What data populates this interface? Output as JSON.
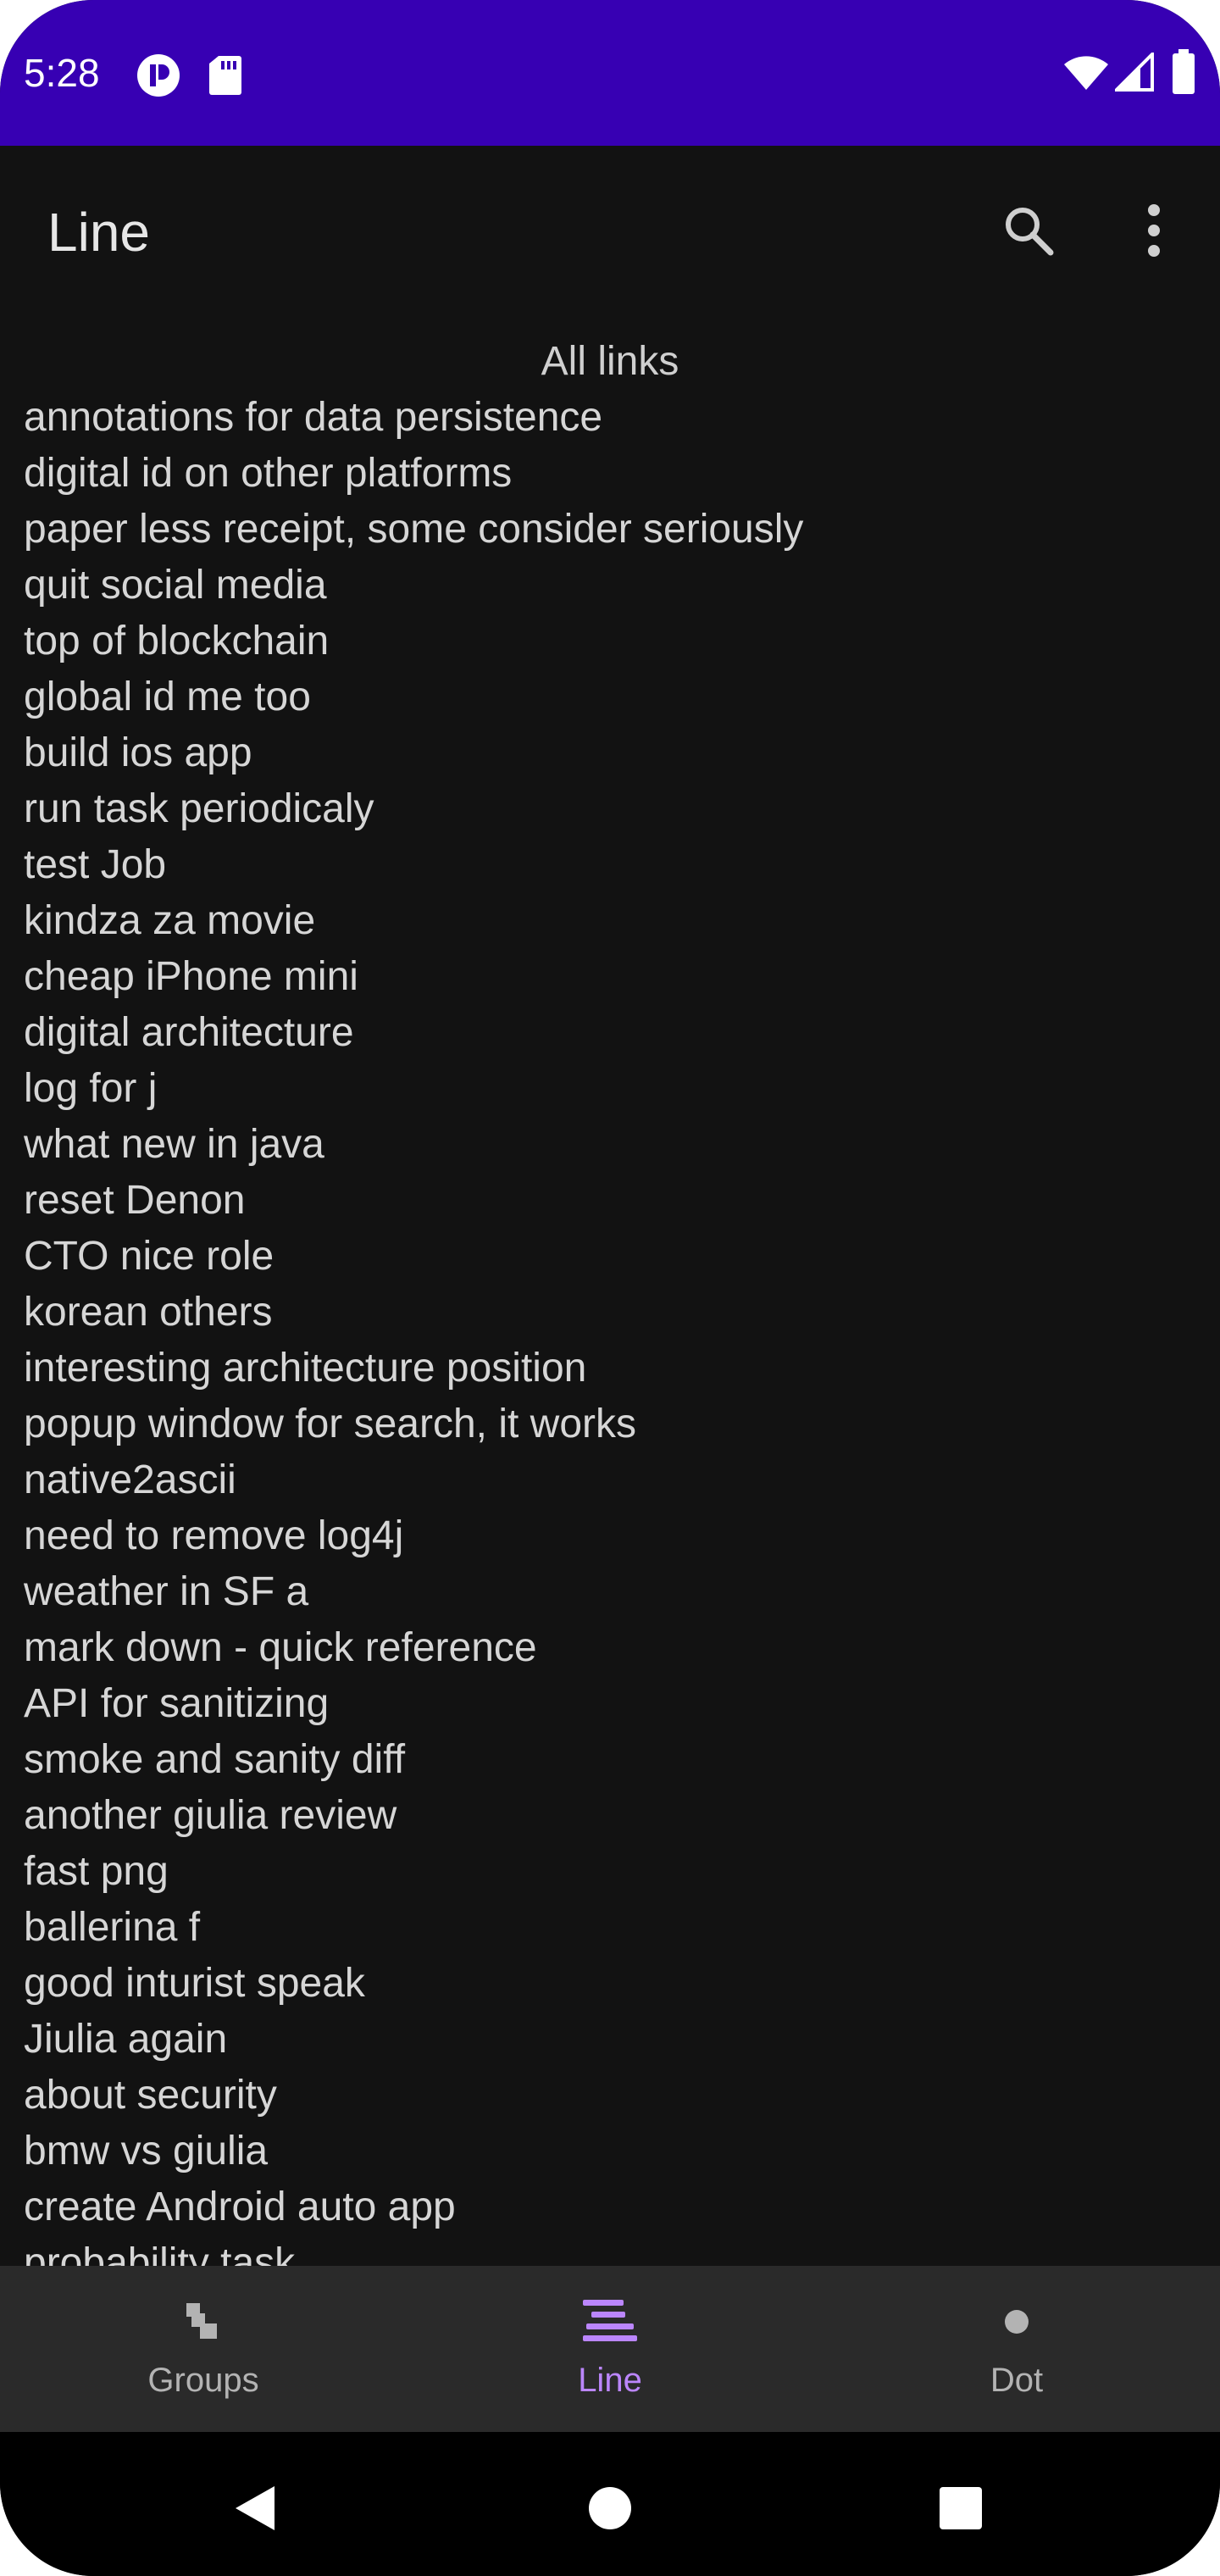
{
  "status_bar": {
    "time": "5:28",
    "background": "#3700b3",
    "icons": [
      "app-notification-icon",
      "sd-card-icon",
      "wifi-icon",
      "cell-signal-icon",
      "battery-icon"
    ]
  },
  "app_bar": {
    "title": "Line",
    "actions": [
      "search-icon",
      "more-vert-icon"
    ]
  },
  "content": {
    "heading": "All links",
    "links": [
      "annotations for data persistence",
      "digital id on other platforms",
      "paper less receipt, some consider seriously",
      "quit social media",
      "top of blockchain",
      "global id me too",
      "build ios app",
      "run task periodicaly",
      "test Job",
      "kindza za movie",
      "cheap iPhone mini",
      "digital architecture",
      "log for j",
      "what new in java",
      "reset Denon",
      "CTO nice role",
      "korean others",
      "interesting architecture position",
      "popup window for search, it works",
      "native2ascii",
      "need to remove log4j",
      "weather in SF a",
      "mark down - quick reference",
      "API for sanitizing",
      "smoke and sanity diff",
      "another giulia review",
      "fast png",
      "ballerina f",
      "good inturist speak",
      "Jiulia again",
      "about security",
      "bmw vs giulia",
      "create Android auto app",
      "probability task"
    ]
  },
  "bottom_nav": {
    "items": [
      {
        "label": "Groups",
        "icon": "groups-icon",
        "active": false
      },
      {
        "label": "Line",
        "icon": "line-icon",
        "active": true
      },
      {
        "label": "Dot",
        "icon": "dot-icon",
        "active": false
      }
    ],
    "active_color": "#bb86fc",
    "inactive_color": "#b3b3b3"
  },
  "system_nav": {
    "buttons": [
      "back-icon",
      "home-icon",
      "recents-icon"
    ]
  }
}
